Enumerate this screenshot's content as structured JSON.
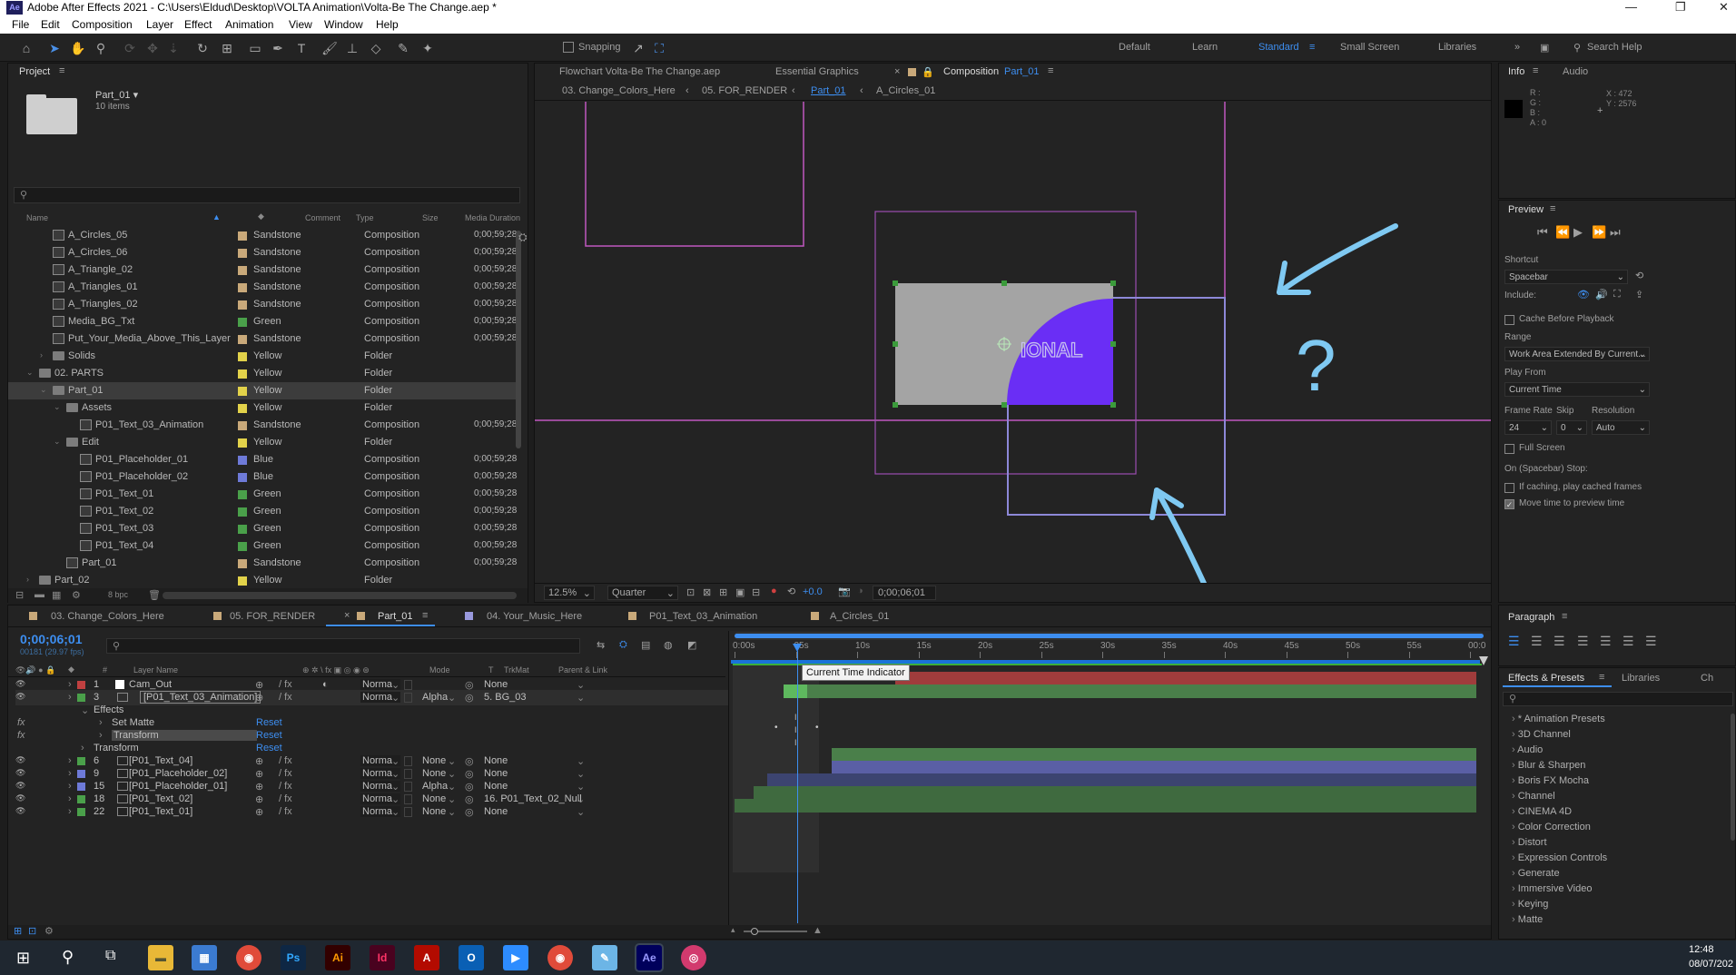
{
  "window": {
    "title": "Adobe After Effects 2021 - C:\\Users\\Eldud\\Desktop\\VOLTA Animation\\Volta-Be The Change.aep *",
    "app_badge": "Ae"
  },
  "menu": [
    "File",
    "Edit",
    "Composition",
    "Layer",
    "Effect",
    "Animation",
    "View",
    "Window",
    "Help"
  ],
  "toolbar": {
    "snapping": "Snapping",
    "workspaces": [
      "Default",
      "Learn",
      "Standard",
      "Small Screen",
      "Libraries"
    ],
    "active_workspace": "Standard",
    "search_placeholder": "Search Help"
  },
  "project": {
    "tab": "Project",
    "selected": "Part_01 ▾",
    "count": "10 items",
    "columns": [
      "Name",
      "Comment",
      "Type",
      "Size",
      "Media Duration"
    ],
    "rows": [
      {
        "name": "A_Circles_05",
        "label": "Sandstone",
        "color": "#c9a97a",
        "type": "Composition",
        "dur": "0;00;59;28",
        "ind": 1,
        "kind": "comp"
      },
      {
        "name": "A_Circles_06",
        "label": "Sandstone",
        "color": "#c9a97a",
        "type": "Composition",
        "dur": "0;00;59;28",
        "ind": 1,
        "kind": "comp"
      },
      {
        "name": "A_Triangle_02",
        "label": "Sandstone",
        "color": "#c9a97a",
        "type": "Composition",
        "dur": "0;00;59;28",
        "ind": 1,
        "kind": "comp"
      },
      {
        "name": "A_Triangles_01",
        "label": "Sandstone",
        "color": "#c9a97a",
        "type": "Composition",
        "dur": "0;00;59;28",
        "ind": 1,
        "kind": "comp"
      },
      {
        "name": "A_Triangles_02",
        "label": "Sandstone",
        "color": "#c9a97a",
        "type": "Composition",
        "dur": "0;00;59;28",
        "ind": 1,
        "kind": "comp"
      },
      {
        "name": "Media_BG_Txt",
        "label": "Green",
        "color": "#4aa04a",
        "type": "Composition",
        "dur": "0;00;59;28",
        "ind": 1,
        "kind": "comp"
      },
      {
        "name": "Put_Your_Media_Above_This_Layer",
        "label": "Sandstone",
        "color": "#c9a97a",
        "type": "Composition",
        "dur": "0;00;59;28",
        "ind": 1,
        "kind": "comp"
      },
      {
        "name": "Solids",
        "label": "Yellow",
        "color": "#e2d24a",
        "type": "Folder",
        "dur": "",
        "ind": 1,
        "kind": "folder",
        "tw": "›"
      },
      {
        "name": "02. PARTS",
        "label": "Yellow",
        "color": "#e2d24a",
        "type": "Folder",
        "dur": "",
        "ind": 0,
        "kind": "folder",
        "tw": "⌄"
      },
      {
        "name": "Part_01",
        "label": "Yellow",
        "color": "#e2d24a",
        "type": "Folder",
        "dur": "",
        "ind": 1,
        "kind": "folder",
        "tw": "⌄",
        "sel": true
      },
      {
        "name": "Assets",
        "label": "Yellow",
        "color": "#e2d24a",
        "type": "Folder",
        "dur": "",
        "ind": 2,
        "kind": "folder",
        "tw": "⌄"
      },
      {
        "name": "P01_Text_03_Animation",
        "label": "Sandstone",
        "color": "#c9a97a",
        "type": "Composition",
        "dur": "0;00;59;28",
        "ind": 3,
        "kind": "comp"
      },
      {
        "name": "Edit",
        "label": "Yellow",
        "color": "#e2d24a",
        "type": "Folder",
        "dur": "",
        "ind": 2,
        "kind": "folder",
        "tw": "⌄"
      },
      {
        "name": "P01_Placeholder_01",
        "label": "Blue",
        "color": "#6e7ad8",
        "type": "Composition",
        "dur": "0;00;59;28",
        "ind": 3,
        "kind": "comp"
      },
      {
        "name": "P01_Placeholder_02",
        "label": "Blue",
        "color": "#6e7ad8",
        "type": "Composition",
        "dur": "0;00;59;28",
        "ind": 3,
        "kind": "comp"
      },
      {
        "name": "P01_Text_01",
        "label": "Green",
        "color": "#4aa04a",
        "type": "Composition",
        "dur": "0;00;59;28",
        "ind": 3,
        "kind": "comp"
      },
      {
        "name": "P01_Text_02",
        "label": "Green",
        "color": "#4aa04a",
        "type": "Composition",
        "dur": "0;00;59;28",
        "ind": 3,
        "kind": "comp"
      },
      {
        "name": "P01_Text_03",
        "label": "Green",
        "color": "#4aa04a",
        "type": "Composition",
        "dur": "0;00;59;28",
        "ind": 3,
        "kind": "comp"
      },
      {
        "name": "P01_Text_04",
        "label": "Green",
        "color": "#4aa04a",
        "type": "Composition",
        "dur": "0;00;59;28",
        "ind": 3,
        "kind": "comp"
      },
      {
        "name": "Part_01",
        "label": "Sandstone",
        "color": "#c9a97a",
        "type": "Composition",
        "dur": "0;00;59;28",
        "ind": 2,
        "kind": "comp"
      },
      {
        "name": "Part_02",
        "label": "Yellow",
        "color": "#e2d24a",
        "type": "Folder",
        "dur": "",
        "ind": 0,
        "kind": "folder",
        "tw": "›"
      }
    ],
    "bpc": "8 bpc"
  },
  "comp_panel": {
    "flowchart_tab": "Flowchart Volta-Be The Change.aep",
    "eg_tab": "Essential Graphics",
    "comp_tab_prefix": "Composition",
    "comp_tab_name": "Part_01",
    "breadcrumbs": [
      "03. Change_Colors_Here",
      "05. FOR_RENDER",
      "Part_01",
      "A_Circles_01"
    ],
    "active_crumb": "Part_01",
    "canvas_text": "IONAL",
    "magnification": "12.5%",
    "resolution": "Quarter",
    "exposure": "+0.0",
    "timecode": "0;00;06;01",
    "question_mark": "?"
  },
  "info": {
    "tabs": [
      "Info",
      "Audio"
    ],
    "channels": "R :\nG :\nB :\nA : 0",
    "x": "X : 472",
    "y": "Y : 2576"
  },
  "preview": {
    "tab": "Preview",
    "shortcut_label": "Shortcut",
    "shortcut": "Spacebar",
    "include_label": "Include:",
    "cache": "Cache Before Playback",
    "range_label": "Range",
    "range": "Work Area Extended By Current...",
    "play_from_label": "Play From",
    "play_from": "Current Time",
    "frame_rate_label": "Frame Rate",
    "skip_label": "Skip",
    "resolution_label": "Resolution",
    "frame_rate": "24",
    "skip": "0",
    "resolution": "Auto",
    "full_screen": "Full Screen",
    "stop_label": "On (Spacebar) Stop:",
    "if_caching": "If caching, play cached frames",
    "move_time": "Move time to preview time"
  },
  "timeline": {
    "tabs": [
      "03. Change_Colors_Here",
      "05. FOR_RENDER",
      "Part_01",
      "04. Your_Music_Here",
      "P01_Text_03_Animation",
      "A_Circles_01"
    ],
    "active_tab": "Part_01",
    "timecode": "0;00;06;01",
    "fps": "00181 (29.97 fps)",
    "headers": [
      "#",
      "Layer Name",
      "Mode",
      "T",
      "TrkMat",
      "Parent & Link"
    ],
    "ruler": [
      "0:00s",
      "05s",
      "10s",
      "15s",
      "20s",
      "25s",
      "30s",
      "35s",
      "40s",
      "45s",
      "50s",
      "55s",
      "00:0"
    ],
    "tooltip": "Current Time Indicator",
    "layers": [
      {
        "num": "1",
        "name": "Cam_Out",
        "color": "#c04040",
        "mode": "Norma",
        "trk": "",
        "parent": "None"
      },
      {
        "num": "3",
        "name": "[P01_Text_03_Animation]",
        "color": "#4aa04a",
        "mode": "Norma",
        "trk": "Alpha",
        "parent": "5. BG_03",
        "sel": true
      },
      {
        "num": "6",
        "name": "[P01_Text_04]",
        "color": "#4aa04a",
        "mode": "Norma",
        "trk": "None",
        "parent": "None"
      },
      {
        "num": "9",
        "name": "[P01_Placeholder_02]",
        "color": "#6e7ad8",
        "mode": "Norma",
        "trk": "None",
        "parent": "None"
      },
      {
        "num": "15",
        "name": "[P01_Placeholder_01]",
        "color": "#6e7ad8",
        "mode": "Norma",
        "trk": "Alpha",
        "parent": "None"
      },
      {
        "num": "18",
        "name": "[P01_Text_02]",
        "color": "#4aa04a",
        "mode": "Norma",
        "trk": "None",
        "parent": "16. P01_Text_02_Null"
      },
      {
        "num": "22",
        "name": "[P01_Text_01]",
        "color": "#4aa04a",
        "mode": "Norma",
        "trk": "None",
        "parent": "None"
      }
    ],
    "effects": {
      "effects_label": "Effects",
      "set_matte": "Set Matte",
      "transform_fx": "Transform",
      "transform": "Transform",
      "reset": "Reset",
      "fx": "fx"
    }
  },
  "paragraph": {
    "tab": "Paragraph"
  },
  "effects_presets": {
    "tabs": [
      "Effects & Presets",
      "Libraries",
      "Ch"
    ],
    "items": [
      "* Animation Presets",
      "3D Channel",
      "Audio",
      "Blur & Sharpen",
      "Boris FX Mocha",
      "Channel",
      "CINEMA 4D",
      "Color Correction",
      "Distort",
      "Expression Controls",
      "Generate",
      "Immersive Video",
      "Keying",
      "Matte"
    ]
  },
  "taskbar": {
    "time": "12:48",
    "date": "08/07/202"
  },
  "colors": {
    "accent": "#2d8ceb",
    "panel": "#232323",
    "highlight": "#7d45f5",
    "annotation": "#7fc9f2"
  }
}
